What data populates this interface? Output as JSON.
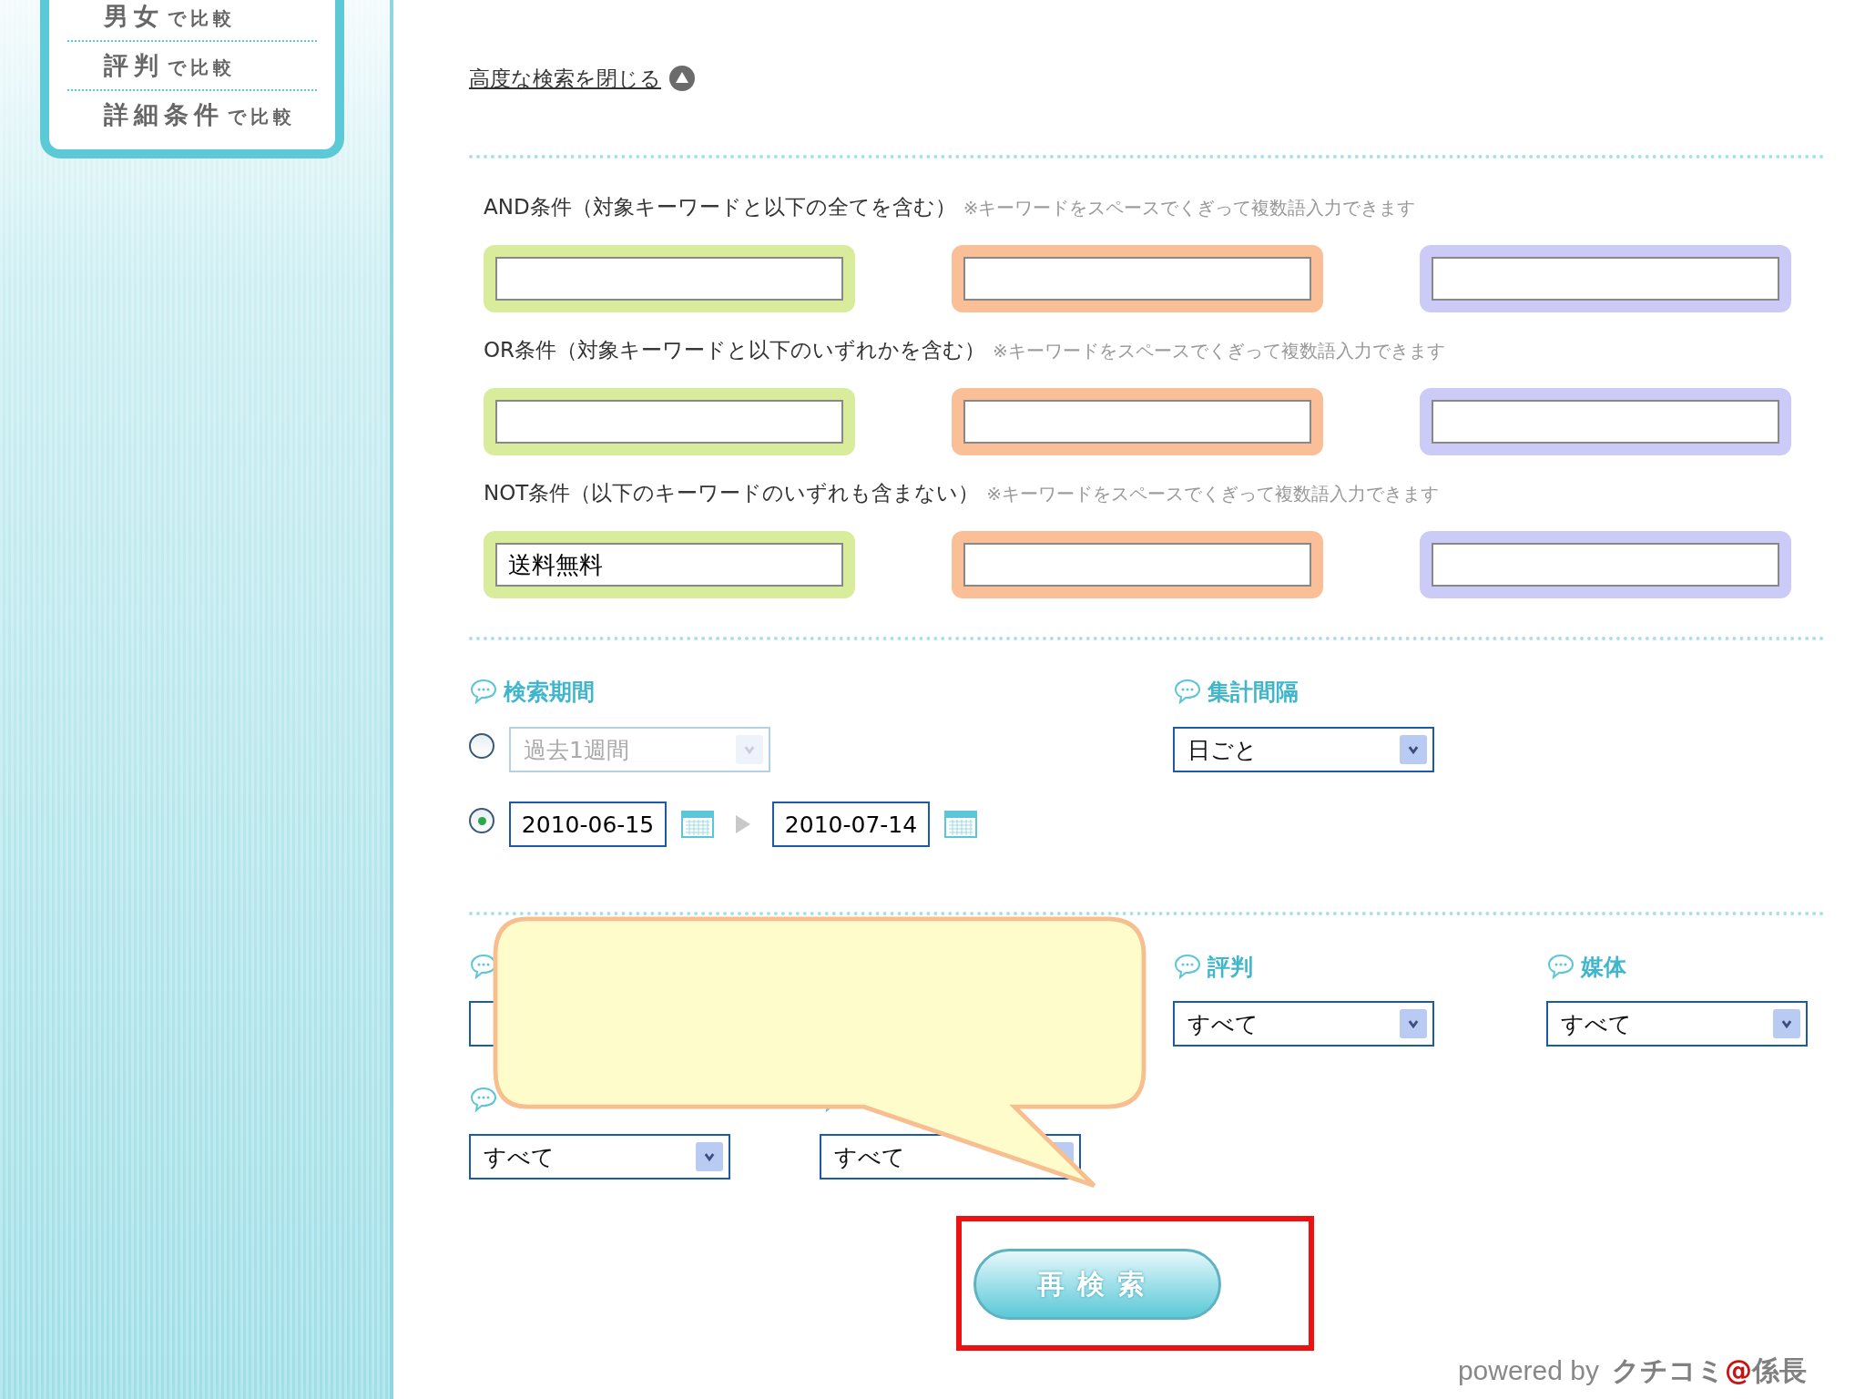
{
  "sidebar": {
    "items": [
      {
        "label": "男女",
        "suffix": "で比較"
      },
      {
        "label": "評判",
        "suffix": "で比較"
      },
      {
        "label": "詳細条件",
        "suffix": "で比較"
      }
    ]
  },
  "advanced_toggle": {
    "label": "高度な検索を閉じる"
  },
  "conditions": [
    {
      "label": "AND条件（対象キーワードと以下の全てを含む）",
      "note": "※キーワードをスペースでくぎって複数語入力できます",
      "fields": [
        {
          "color": "#d8ec9b"
        },
        {
          "color": "#fbbf98"
        },
        {
          "color": "#cccaf7"
        }
      ]
    },
    {
      "label": "OR条件（対象キーワードと以下のいずれかを含む）",
      "note": "※キーワードをスペースでくぎって複数語入力できます",
      "fields": [
        {
          "color": "#d8ec9b"
        },
        {
          "color": "#fbbf98"
        },
        {
          "color": "#cccaf7"
        }
      ]
    },
    {
      "label": "NOT条件（以下のキーワードのいずれも含まない）",
      "note": "※キーワードをスペースでくぎって複数語入力できます",
      "fields": [
        {
          "color": "#d8ec9b",
          "value": "送料無料"
        },
        {
          "color": "#fbbf98"
        },
        {
          "color": "#cccaf7"
        }
      ]
    }
  ],
  "period": {
    "heading": "検索期間",
    "options": [
      {
        "kind": "preset",
        "selected": false,
        "disabled": true,
        "value": "過去1週間"
      },
      {
        "kind": "range",
        "selected": true,
        "from": "2010-06-15",
        "to": "2010-07-14"
      }
    ]
  },
  "interval": {
    "heading": "集計間隔",
    "value": "日ごと"
  },
  "filter_rows": [
    [
      {
        "covered": true
      },
      {
        "covered": false,
        "heading": "評判",
        "value": "すべて"
      },
      {
        "covered": false,
        "heading": "媒体",
        "value": "すべて"
      }
    ],
    [
      {
        "covered": false,
        "value": "すべて"
      },
      {
        "covered": false,
        "value": "すべて"
      }
    ]
  ],
  "callout": {
    "kind": "callout"
  },
  "search_button": {
    "label": "再検索",
    "highlighted": true
  },
  "footer": {
    "text": "powered by",
    "brand": [
      {
        "text": "クチコミ",
        "color": "#808080"
      },
      {
        "text": "@",
        "color": "#cc1111"
      },
      {
        "text": "係長",
        "color": "#808080"
      }
    ]
  }
}
